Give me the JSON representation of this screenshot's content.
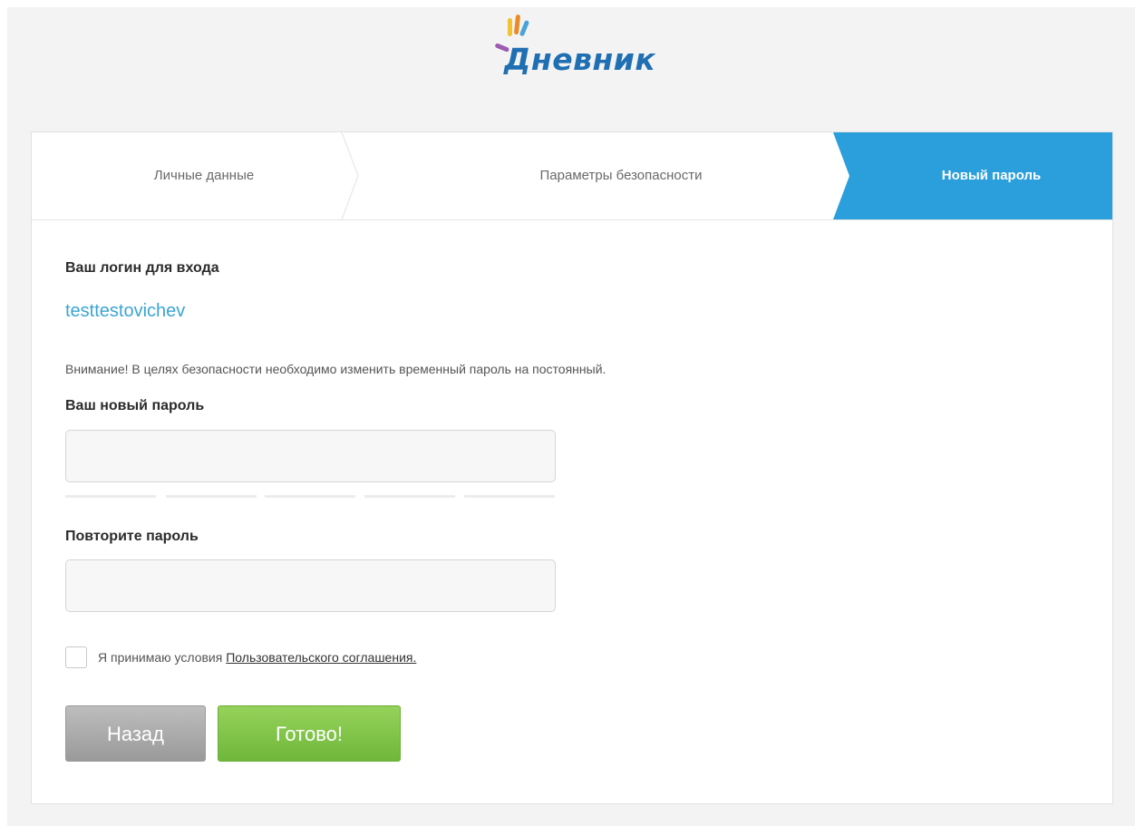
{
  "logo": {
    "text": "Дневник",
    "brand_color": "#1f6fb2"
  },
  "steps": [
    {
      "label": "Личные данные",
      "active": false
    },
    {
      "label": "Параметры безопасности",
      "active": false
    },
    {
      "label": "Новый пароль",
      "active": true
    }
  ],
  "colors": {
    "active_step": "#2b9fdb",
    "login_link": "#3ba5d4",
    "back_button": "#a9a9a9",
    "done_button": "#80c249"
  },
  "form": {
    "login_label": "Ваш логин для входа",
    "login_value": "testtestovichev",
    "notice": "Внимание! В целях безопасности необходимо изменить временный пароль на постоянный.",
    "new_password_label": "Ваш новый пароль",
    "new_password_value": "",
    "repeat_password_label": "Повторите пароль",
    "repeat_password_value": "",
    "agree_checked": false,
    "agree_text": "Я принимаю условия",
    "agree_link": "Пользовательского соглашения."
  },
  "buttons": {
    "back": "Назад",
    "done": "Готово!"
  }
}
